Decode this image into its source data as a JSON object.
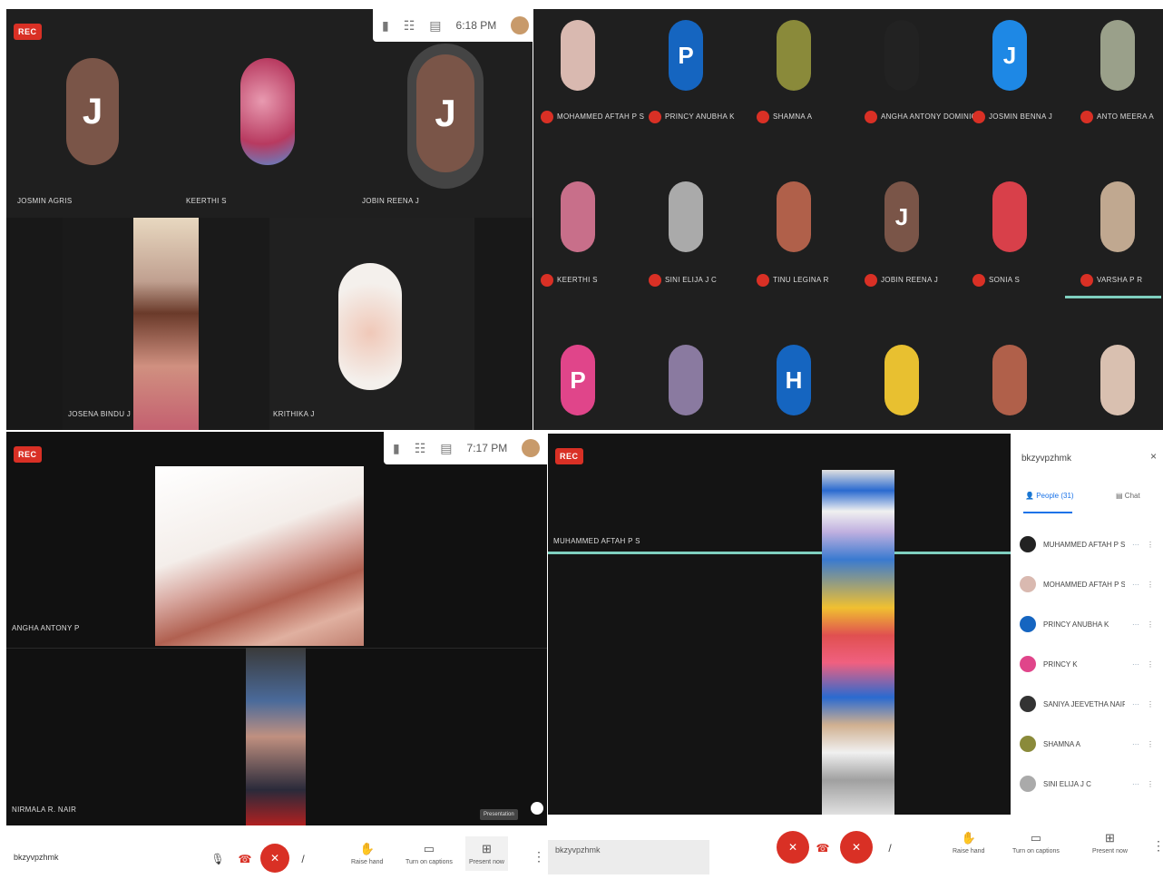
{
  "rec_label": "REC",
  "panel_tl": {
    "time": "6:18 PM",
    "participants": [
      {
        "initial": "J",
        "name": "JOSMIN AGRIS",
        "avatar_color": "#7a5548"
      },
      {
        "initial": "",
        "name": "KEERTHI S",
        "avatar_color": "#c86f8a"
      },
      {
        "initial": "J",
        "name": "JOBIN REENA J",
        "avatar_color": "#7a5548"
      },
      {
        "initial": "",
        "name": "JOSENA BINDU J",
        "avatar_color": "#b08060"
      },
      {
        "initial": "",
        "name": "KRITHIKA J",
        "avatar_color": "#e8d8d0"
      }
    ]
  },
  "panel_tr": {
    "participants": [
      {
        "initial": "",
        "name": "MOHAMMED AFTAH P S",
        "avatar_color": "#d9b9b0"
      },
      {
        "initial": "P",
        "name": "PRINCY ANUBHA K",
        "avatar_color": "#1565c0"
      },
      {
        "initial": "",
        "name": "SHAMNA A",
        "avatar_color": "#8a8a3a"
      },
      {
        "initial": "",
        "name": "ANGHA ANTONY DOMINIC",
        "avatar_color": "#222222"
      },
      {
        "initial": "J",
        "name": "JOSMIN BENNA J",
        "avatar_color": "#1e88e5"
      },
      {
        "initial": "",
        "name": "ANTO MEERA A",
        "avatar_color": "#9aa08a"
      },
      {
        "initial": "",
        "name": "KEERTHI S",
        "avatar_color": "#c86f8a"
      },
      {
        "initial": "",
        "name": "SINI ELIJA J C",
        "avatar_color": "#aaaaaa"
      },
      {
        "initial": "",
        "name": "TINU LEGINA R",
        "avatar_color": "#b0604a"
      },
      {
        "initial": "J",
        "name": "JOBIN REENA J",
        "avatar_color": "#7a5548"
      },
      {
        "initial": "",
        "name": "SONIA S",
        "avatar_color": "#d8404a"
      },
      {
        "initial": "",
        "name": "VARSHA P R",
        "avatar_color": "#c0a890"
      },
      {
        "initial": "P",
        "name": "",
        "avatar_color": "#e0458a"
      },
      {
        "initial": "",
        "name": "",
        "avatar_color": "#8a7aa0"
      },
      {
        "initial": "H",
        "name": "",
        "avatar_color": "#1565c0"
      },
      {
        "initial": "",
        "name": "",
        "avatar_color": "#e8c030"
      },
      {
        "initial": "",
        "name": "",
        "avatar_color": "#b0604a"
      },
      {
        "initial": "",
        "name": "",
        "avatar_color": "#d9c0b0"
      }
    ]
  },
  "panel_bl": {
    "time": "7:17 PM",
    "speaker_top": "ANGHA ANTONY P",
    "speaker_bottom": "NIRMALA R. NAIR",
    "meeting_code": "bkzyvpzhmk",
    "toolbar": {
      "raise_hand": "Raise hand",
      "captions": "Turn on captions",
      "present": "Present now"
    },
    "tooltip": "Presentation"
  },
  "panel_br": {
    "presenter_label": "MUHAMMED AFTAH P S",
    "meeting_code": "bkzyvpzhmk",
    "side_panel": {
      "title": "bkzyvpzhmk",
      "tab_people": "People (31)",
      "tab_chat": "Chat",
      "people": [
        {
          "name": "MUHAMMED AFTAH P S",
          "avatar_color": "#222222"
        },
        {
          "name": "MOHAMMED AFTAH P S",
          "avatar_color": "#d9b9b0"
        },
        {
          "name": "PRINCY ANUBHA K",
          "avatar_color": "#1565c0"
        },
        {
          "name": "PRINCY K",
          "avatar_color": "#e0458a"
        },
        {
          "name": "SANIYA JEEVETHA NAIR J",
          "avatar_color": "#333333"
        },
        {
          "name": "SHAMNA A",
          "avatar_color": "#8a8a3a"
        },
        {
          "name": "SINI ELIJA J C",
          "avatar_color": "#aaaaaa"
        }
      ]
    },
    "toolbar": {
      "raise_hand": "Raise hand",
      "captions": "Turn on captions",
      "present": "Present now"
    }
  }
}
